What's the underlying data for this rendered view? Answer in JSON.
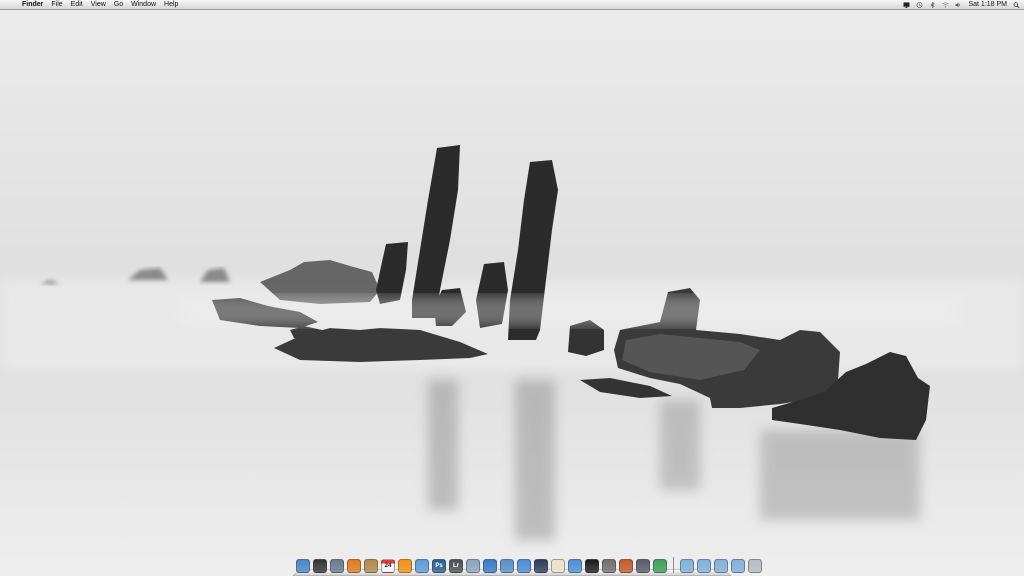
{
  "menubar": {
    "apple_glyph": "",
    "app_name": "Finder",
    "menus": [
      "File",
      "Edit",
      "View",
      "Go",
      "Window",
      "Help"
    ],
    "clock": "Sat 1:18 PM",
    "status_icons": [
      "display-icon",
      "time-machine-icon",
      "bluetooth-icon",
      "wifi-icon",
      "volume-icon",
      "spotlight-icon"
    ]
  },
  "dock": {
    "apps": [
      {
        "name": "finder-icon",
        "label": "",
        "color": "#4a86c8"
      },
      {
        "name": "dashboard-icon",
        "label": "",
        "color": "#333333"
      },
      {
        "name": "system-preferences-icon",
        "label": "",
        "color": "#6a7b8c"
      },
      {
        "name": "firefox-icon",
        "label": "",
        "color": "#e07a1f"
      },
      {
        "name": "address-book-icon",
        "label": "",
        "color": "#b08a4a"
      },
      {
        "name": "ical-icon",
        "label": "24",
        "color": "#d8d8d8"
      },
      {
        "name": "vlc-icon",
        "label": "",
        "color": "#f29016"
      },
      {
        "name": "itunes-icon",
        "label": "",
        "color": "#5a9bd8"
      },
      {
        "name": "photoshop-icon",
        "label": "Ps",
        "color": "#2a5d8f"
      },
      {
        "name": "lightroom-icon",
        "label": "Lr",
        "color": "#4a4f55"
      },
      {
        "name": "preview-icon",
        "label": "",
        "color": "#8aa4bf"
      },
      {
        "name": "iphoto-icon",
        "label": "",
        "color": "#3b7bc4"
      },
      {
        "name": "xcode-icon",
        "label": "",
        "color": "#5a8fc8"
      },
      {
        "name": "safari-icon",
        "label": "",
        "color": "#4b8bd2"
      },
      {
        "name": "aperture-icon",
        "label": "",
        "color": "#2c3c5c"
      },
      {
        "name": "textedit-icon",
        "label": "",
        "color": "#e9e3c8"
      },
      {
        "name": "pages-icon",
        "label": "",
        "color": "#4a90d9"
      },
      {
        "name": "terminal-icon",
        "label": "",
        "color": "#1a1a1a"
      },
      {
        "name": "activity-monitor-icon",
        "label": "",
        "color": "#707070"
      },
      {
        "name": "keynote-icon",
        "label": "",
        "color": "#c25a2a"
      },
      {
        "name": "script-editor-icon",
        "label": "",
        "color": "#5a5a6a"
      },
      {
        "name": "numbers-icon",
        "label": "",
        "color": "#3ca05a"
      }
    ],
    "folders": [
      {
        "name": "applications-folder-icon",
        "color": "#7fb0d8"
      },
      {
        "name": "documents-folder-icon",
        "color": "#7fb0d8"
      },
      {
        "name": "downloads-folder-icon",
        "color": "#7fb0d8"
      },
      {
        "name": "pictures-folder-icon",
        "color": "#7fb0d8"
      }
    ],
    "trash": {
      "name": "trash-icon",
      "color": "#b8bcc0"
    }
  }
}
